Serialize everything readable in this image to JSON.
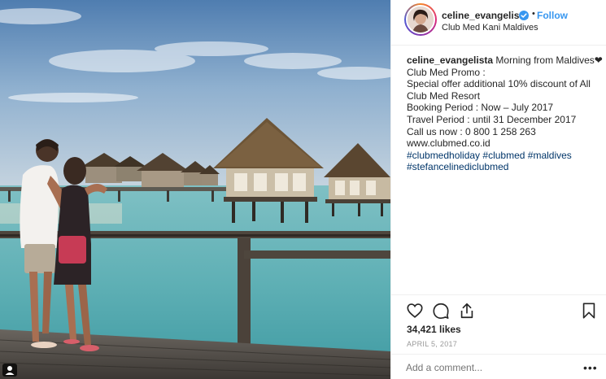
{
  "post": {
    "username": "celine_evangelista",
    "dot": "•",
    "follow_label": "Follow",
    "location": "Club Med Kani Maldives",
    "caption_text": "Morning from Maldives",
    "caption_heart": "❤",
    "caption_lines": [
      "Club Med Promo :",
      "Special offer additional 10% discount of All",
      "Club Med Resort",
      "Booking Period : Now – July 2017",
      "Travel Period : until 31 December 2017",
      "Call us now : 0 800 1 258 263",
      "www.clubmed.co.id"
    ],
    "hashtags_line1": [
      "#clubmedholiday",
      "#clubmed",
      "#maldives"
    ],
    "hashtags_line2": [
      "#stefancelinediclubmed"
    ],
    "likes": "34,421 likes",
    "date": "APRIL 5, 2017",
    "comment_placeholder": "Add a comment...",
    "more": "•••"
  },
  "icons": {
    "verified": "verified-badge-icon",
    "like": "heart-outline-icon",
    "comment": "comment-bubble-icon",
    "share": "share-upload-icon",
    "save": "bookmark-icon",
    "corner": "user-tag-icon"
  },
  "colors": {
    "link": "#3897f0",
    "hashtag": "#003569",
    "text": "#262626",
    "muted": "#999999",
    "border": "#efefef"
  }
}
